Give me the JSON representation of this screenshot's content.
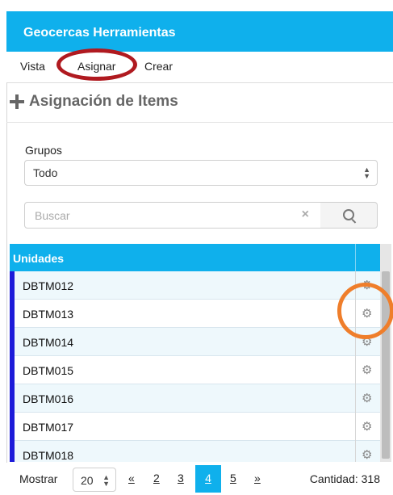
{
  "header": {
    "title": "Geocercas Herramientas"
  },
  "tabs": [
    {
      "label": "Vista"
    },
    {
      "label": "Asignar"
    },
    {
      "label": "Crear"
    }
  ],
  "section": {
    "title": "Asignación de Items"
  },
  "groups": {
    "label": "Grupos",
    "selected": "Todo"
  },
  "search": {
    "placeholder": "Buscar",
    "value": ""
  },
  "table": {
    "header": "Unidades",
    "rows": [
      {
        "name": "DBTM012"
      },
      {
        "name": "DBTM013"
      },
      {
        "name": "DBTM014"
      },
      {
        "name": "DBTM015"
      },
      {
        "name": "DBTM016"
      },
      {
        "name": "DBTM017"
      },
      {
        "name": "DBTM018"
      }
    ]
  },
  "pagination": {
    "show_label": "Mostrar",
    "page_size": "20",
    "prev": "«",
    "pages": [
      "2",
      "3",
      "4",
      "5"
    ],
    "active_page": "4",
    "next": "»",
    "count_label": "Cantidad: 318"
  },
  "colors": {
    "accent": "#0fb0ec",
    "row_marker": "#1d1bd9",
    "highlight_red": "#b01a20",
    "highlight_orange": "#ef7e2b"
  }
}
